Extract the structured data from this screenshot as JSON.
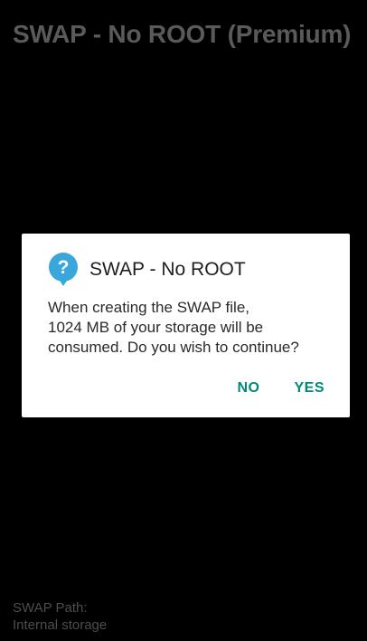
{
  "app": {
    "title": "SWAP - No ROOT (Premium)"
  },
  "footer": {
    "path_label": "SWAP Path:",
    "path_value": "Internal storage"
  },
  "dialog": {
    "icon": "help-question-bubble-icon",
    "title": "SWAP - No ROOT",
    "message_lines": [
      "When creating the SWAP file,",
      "1024 MB of your storage will be",
      "consumed. Do you wish to continue?"
    ],
    "buttons": {
      "no_label": "NO",
      "yes_label": "YES"
    }
  },
  "colors": {
    "background": "#000000",
    "dialog_background": "#ffffff",
    "accent": "#00897b",
    "icon_blue": "#3aa7dc",
    "dim_text": "#5a5a5a"
  }
}
